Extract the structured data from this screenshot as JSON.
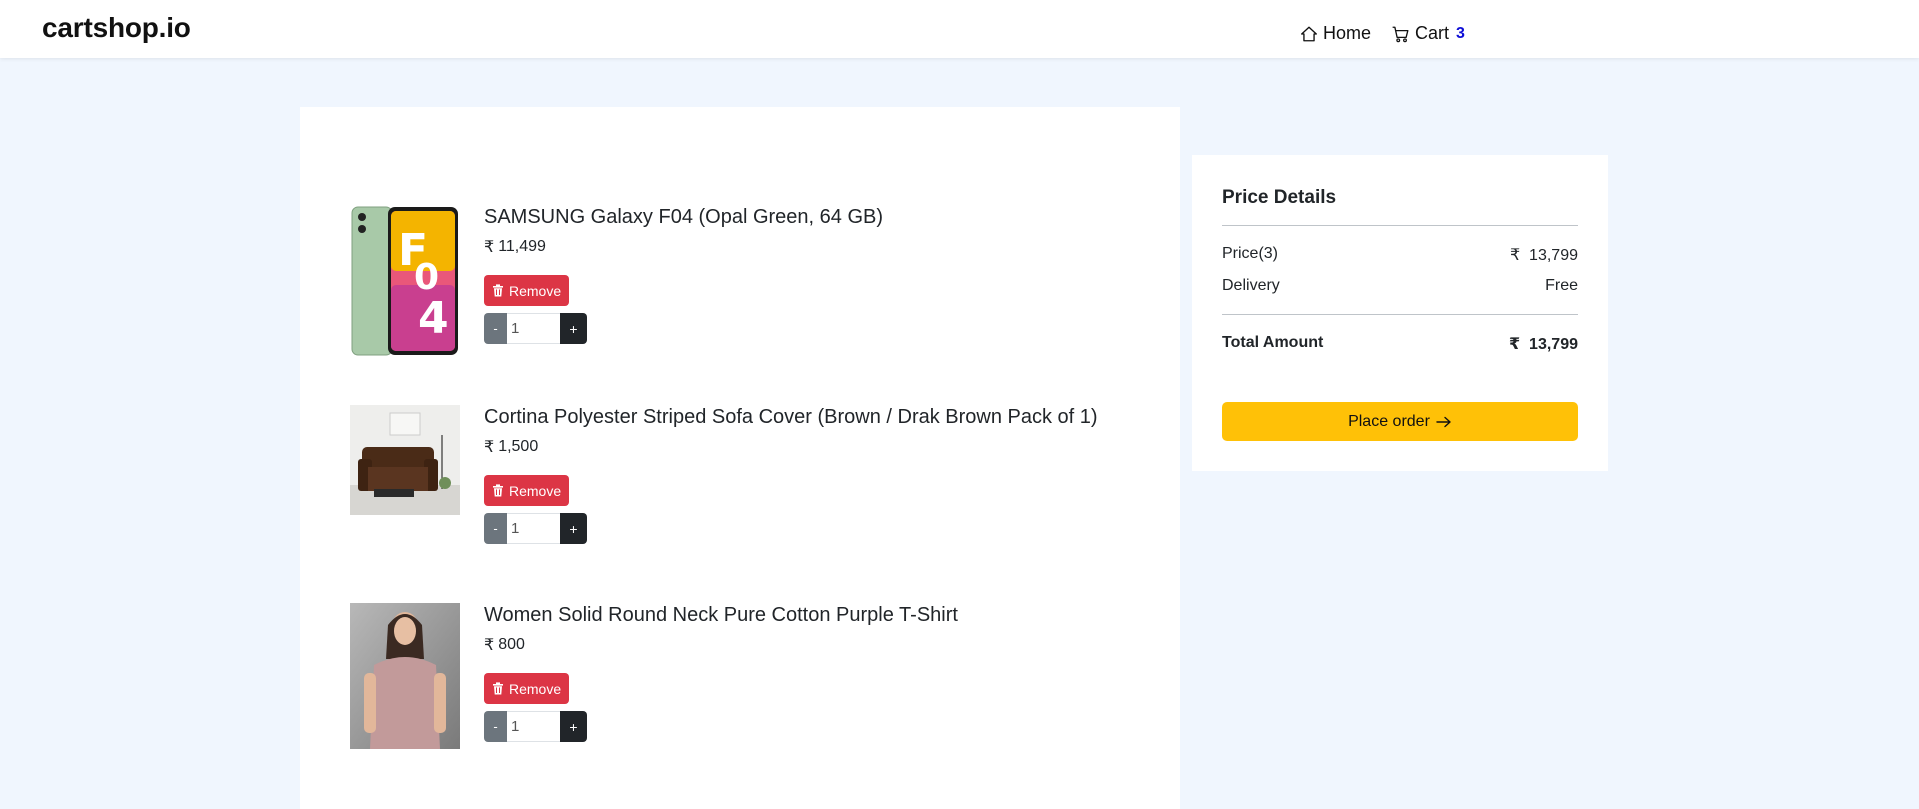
{
  "nav": {
    "brand": "cartshop.io",
    "home_label": "Home",
    "cart_label": "Cart",
    "cart_count": "3"
  },
  "cart": {
    "currency_symbol": "₹",
    "remove_label": "Remove",
    "minus_label": "-",
    "plus_label": "+",
    "items": [
      {
        "title": "SAMSUNG Galaxy F04 (Opal Green, 64 GB)",
        "price": "11,499",
        "quantity": "1"
      },
      {
        "title": "Cortina Polyester Striped Sofa Cover (Brown / Drak Brown Pack of 1)",
        "price": "1,500",
        "quantity": "1"
      },
      {
        "title": "Women Solid Round Neck Pure Cotton Purple T-Shirt",
        "price": "800",
        "quantity": "1"
      }
    ]
  },
  "price_details": {
    "title": "Price Details",
    "price_label": "Price(3)",
    "price_value": "₹  13,799",
    "delivery_label": "Delivery",
    "delivery_value": "Free",
    "total_label": "Total Amount",
    "total_value": "₹  13,799",
    "place_order_label": "Place order"
  },
  "colors": {
    "page_bg": "#f0f6fe",
    "remove_red": "#dc3545",
    "place_order_yellow": "#ffc107",
    "cart_count_blue": "#0d0dd6"
  }
}
